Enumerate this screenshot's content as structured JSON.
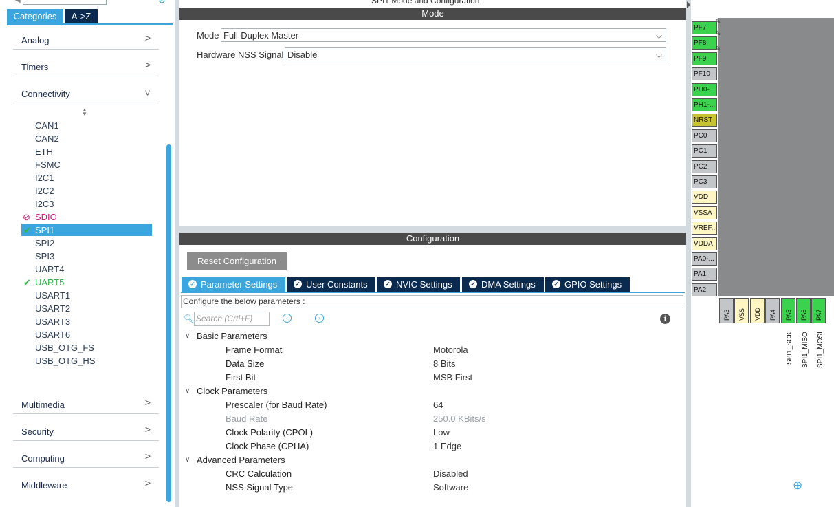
{
  "window_title_clip": "SPI1 Mode and Configuration",
  "left": {
    "tabs": {
      "categories": "Categories",
      "az": "A->Z"
    },
    "categories_top": [
      {
        "label": "Analog",
        "chev": ">"
      },
      {
        "label": "Timers",
        "chev": ">"
      },
      {
        "label": "Connectivity",
        "chev": "v"
      }
    ],
    "connectivity_items": [
      "CAN1",
      "CAN2",
      "ETH",
      "FSMC",
      "I2C1",
      "I2C2",
      "I2C3",
      "SDIO",
      "SPI1",
      "SPI2",
      "SPI3",
      "UART4",
      "UART5",
      "USART1",
      "USART2",
      "USART3",
      "USART6",
      "USB_OTG_FS",
      "USB_OTG_HS"
    ],
    "categories_bottom": [
      {
        "label": "Multimedia",
        "chev": ">"
      },
      {
        "label": "Security",
        "chev": ">"
      },
      {
        "label": "Computing",
        "chev": ">"
      },
      {
        "label": "Middleware",
        "chev": ">"
      }
    ],
    "colors": {
      "accent": "#3aa6dd",
      "dark": "#0b2a50",
      "disabled": "#d4147a",
      "ok": "#2fb34a"
    }
  },
  "mode": {
    "section_title": "Mode",
    "mode_label": "Mode",
    "mode_value": "Full-Duplex Master",
    "nss_label": "Hardware NSS Signal",
    "nss_value": "Disable"
  },
  "config": {
    "section_title": "Configuration",
    "reset_button": "Reset Configuration",
    "tabs": [
      "Parameter Settings",
      "User Constants",
      "NVIC Settings",
      "DMA Settings",
      "GPIO Settings"
    ],
    "description": "Configure the below parameters :",
    "search_placeholder": "Search (Crtl+F)",
    "groups": [
      {
        "name": "Basic Parameters",
        "params": [
          {
            "name": "Frame Format",
            "value": "Motorola"
          },
          {
            "name": "Data Size",
            "value": "8 Bits"
          },
          {
            "name": "First Bit",
            "value": "MSB First"
          }
        ]
      },
      {
        "name": "Clock Parameters",
        "params": [
          {
            "name": "Prescaler (for Baud Rate)",
            "value": "64"
          },
          {
            "name": "Baud Rate",
            "value": "250.0 KBits/s"
          },
          {
            "name": "Clock Polarity (CPOL)",
            "value": "Low"
          },
          {
            "name": "Clock Phase (CPHA)",
            "value": "1 Edge"
          }
        ]
      },
      {
        "name": "Advanced Parameters",
        "params": [
          {
            "name": "CRC Calculation",
            "value": "Disabled"
          },
          {
            "name": "NSS Signal Type",
            "value": "Software"
          }
        ]
      }
    ]
  },
  "chip": {
    "left_pins": [
      {
        "label": "PF7",
        "color": "green"
      },
      {
        "label": "PF8",
        "color": "green"
      },
      {
        "label": "PF9",
        "color": "green"
      },
      {
        "label": "PF10",
        "color": "gray"
      },
      {
        "label": "PH0-...",
        "color": "green"
      },
      {
        "label": "PH1-...",
        "color": "green"
      },
      {
        "label": "NRST",
        "color": "olive"
      },
      {
        "label": "PC0",
        "color": "gray"
      },
      {
        "label": "PC1",
        "color": "gray"
      },
      {
        "label": "PC2",
        "color": "gray"
      },
      {
        "label": "PC3",
        "color": "gray"
      },
      {
        "label": "VDD",
        "color": "yellow"
      },
      {
        "label": "VSSA",
        "color": "yellow"
      },
      {
        "label": "VREF...",
        "color": "yellow"
      },
      {
        "label": "VDDA",
        "color": "yellow"
      },
      {
        "label": "PA0-...",
        "color": "gray"
      },
      {
        "label": "PA1",
        "color": "gray"
      },
      {
        "label": "PA2",
        "color": "gray"
      }
    ],
    "bottom_pins": [
      {
        "label": "PA3",
        "color": "gray"
      },
      {
        "label": "VSS",
        "color": "yellow"
      },
      {
        "label": "VDD",
        "color": "yellow"
      },
      {
        "label": "PA4",
        "color": "gray"
      },
      {
        "label": "PA5",
        "color": "green"
      },
      {
        "label": "PA6",
        "color": "green"
      },
      {
        "label": "PA7",
        "color": "green"
      }
    ],
    "signal_labels": [
      "SPI1_SCK",
      "SPI1_MISO",
      "SPI1_MOSI"
    ]
  }
}
